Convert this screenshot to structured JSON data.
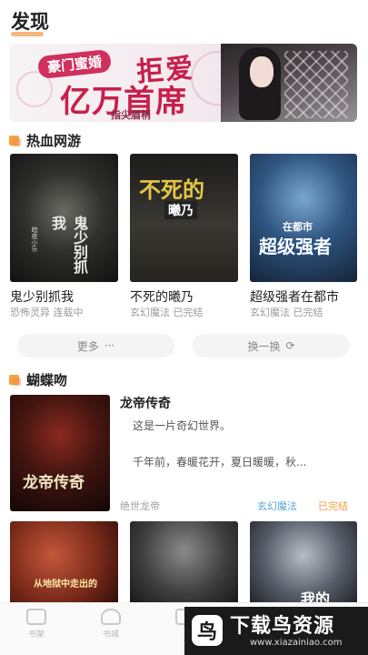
{
  "page": {
    "title": "发现"
  },
  "banner": {
    "tag": "豪门蜜婚",
    "headline_1": "拒爱",
    "headline_2": "亿万首席",
    "author": "指尖眉梢"
  },
  "section_1": {
    "title": "热血网游",
    "books": [
      {
        "name": "鬼少别抓我",
        "meta": "恐怖灵异 连载中",
        "cover_text": "鬼少别抓我",
        "cover_sub": "暗夜小乐"
      },
      {
        "name": "不死的曦乃",
        "meta": "玄幻魔法 已完结",
        "cover_text": "不死的",
        "cover_sub": "曦乃"
      },
      {
        "name": "超级强者在都市",
        "meta": "玄幻魔法 已完结",
        "cover_text": "超级强者",
        "cover_sub": "在都市"
      }
    ],
    "more_label": "更多",
    "more_icon": "ellipsis-icon",
    "refresh_label": "换一换",
    "refresh_icon": "refresh-icon"
  },
  "section_2": {
    "title": "蝴蝶吻",
    "featured": {
      "title": "龙帝传奇",
      "desc_1": "这是一片奇幻世界。",
      "desc_2": "千年前，春暖花开，夏日暖暖，秋...",
      "author": "绝世龙帝",
      "genre": "玄幻魔法",
      "status": "已完结",
      "cover_text": "龙帝传奇"
    },
    "row": [
      {
        "cover_text": "从地狱中走出的"
      },
      {
        "cover_text": ""
      },
      {
        "cover_text": "我的"
      }
    ]
  },
  "tabbar": [
    {
      "label": "书架",
      "icon": "bookshelf-icon"
    },
    {
      "label": "书城",
      "icon": "bookstore-icon"
    },
    {
      "label": "",
      "icon": "discover-icon"
    }
  ],
  "watermark": {
    "logo": "鸟",
    "title": "下载鸟资源",
    "url": "www.xiazainiao.com"
  },
  "colors": {
    "accent": "#f4a25c",
    "section_icon": "#f3a43b",
    "genre": "#58a4d6",
    "status": "#f0a040"
  }
}
